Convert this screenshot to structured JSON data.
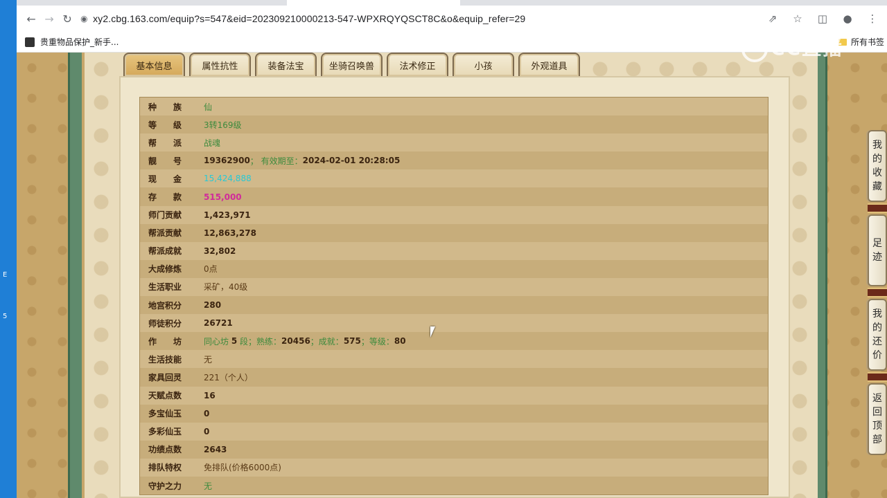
{
  "browser": {
    "url": "xy2.cbg.163.com/equip?s=547&eid=202309210000213-547-WPXRQYQSCT8C&o&equip_refer=29",
    "bookmark_left": "贵重物品保护_新手...",
    "bookmark_right": "所有书签"
  },
  "watermark": "CC直播",
  "tabs": [
    "基本信息",
    "属性抗性",
    "装备法宝",
    "坐骑召唤兽",
    "法术修正",
    "小孩",
    "外观道具"
  ],
  "rows": {
    "race": {
      "label": "种族",
      "value": "仙"
    },
    "level": {
      "label": "等级",
      "value": "3转169级"
    },
    "faction": {
      "label": "帮派",
      "value": "战魂"
    },
    "id": {
      "label": "靓号",
      "value": "19362900",
      "sep": "；",
      "expire_label": "有效期至：",
      "expire_value": "2024-02-01 20:28:05"
    },
    "cash": {
      "label": "现金",
      "value": "15,424,888"
    },
    "deposit": {
      "label": "存款",
      "value": "515,000"
    },
    "school_contrib": {
      "label": "师门贡献",
      "value": "1,423,971"
    },
    "faction_contrib": {
      "label": "帮派贡献",
      "value": "12,863,278"
    },
    "faction_achieve": {
      "label": "帮派成就",
      "value": "32,802"
    },
    "cultivation": {
      "label": "大成修炼",
      "value": "0点"
    },
    "life_job": {
      "label": "生活职业",
      "value": "采矿，40级"
    },
    "palace_points": {
      "label": "地宫积分",
      "value": "280"
    },
    "mentor_points": {
      "label": "师徒积分",
      "value": "26721"
    },
    "workshop": {
      "label": "作坊",
      "p1": "同心坊",
      "v1": "5",
      "p2": "段；熟练：",
      "v2": "20456",
      "p3": "；成就：",
      "v3": "575",
      "p4": "；等级：",
      "v4": "80"
    },
    "life_skill": {
      "label": "生活技能",
      "value": "无"
    },
    "furniture": {
      "label": "家具回灵",
      "value": "221（个人）"
    },
    "talent": {
      "label": "天赋点数",
      "value": "16"
    },
    "duobao": {
      "label": "多宝仙玉",
      "value": "0"
    },
    "duocai": {
      "label": "多彩仙玉",
      "value": "0"
    },
    "merit": {
      "label": "功绩点数",
      "value": "2643"
    },
    "queue": {
      "label": "排队特权",
      "value": "免排队(价格6000点)"
    },
    "guard": {
      "label": "守护之力",
      "value": "无"
    }
  },
  "side_buttons": [
    {
      "chars": [
        "我",
        "的",
        "收",
        "藏"
      ]
    },
    {
      "chars": [
        "足",
        "迹"
      ]
    },
    {
      "chars": [
        "我",
        "的",
        "还",
        "价"
      ]
    },
    {
      "chars": [
        "返",
        "回",
        "顶",
        "部"
      ]
    }
  ]
}
